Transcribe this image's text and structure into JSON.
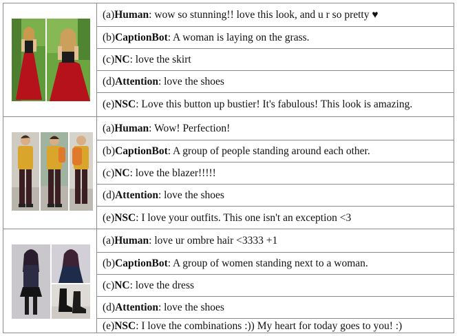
{
  "examples": [
    {
      "images": [
        "woman-red-skirt-photo-left",
        "woman-red-skirt-photo-right"
      ],
      "captions": [
        {
          "prefix": "(a) ",
          "model": "Human",
          "text": ": wow so stunning!! love this look, and u r so pretty ♥"
        },
        {
          "prefix": "(b) ",
          "model": "CaptionBot",
          "text": ": A woman is laying on the grass."
        },
        {
          "prefix": "(c) ",
          "model": "NC",
          "text": ": love the skirt"
        },
        {
          "prefix": "(d) ",
          "model": "Attention",
          "text": ": love the shoes"
        },
        {
          "prefix": "(e) ",
          "model": "NSC",
          "text": ": Love this button up bustier! It's fabulous! This look is amazing."
        }
      ]
    },
    {
      "images": [
        "man-yellow-sweater-photo-1",
        "man-yellow-sweater-photo-2",
        "man-yellow-sweater-photo-3"
      ],
      "captions": [
        {
          "prefix": "(a) ",
          "model": "Human",
          "text": ": Wow! Perfection!"
        },
        {
          "prefix": "(b) ",
          "model": "CaptionBot",
          "text": ": A group of people standing around each other."
        },
        {
          "prefix": "(c) ",
          "model": "NC",
          "text": ": love the blazer!!!!!"
        },
        {
          "prefix": "(d) ",
          "model": "Attention",
          "text": ": love the shoes"
        },
        {
          "prefix": "(e) ",
          "model": "NSC",
          "text": ": I love your outfits. This one isn't an exception <3"
        }
      ]
    },
    {
      "images": [
        "woman-ombre-hair-photo-1",
        "woman-ombre-hair-photo-2",
        "ankle-boots-photo"
      ],
      "captions": [
        {
          "prefix": "(a) ",
          "model": "Human",
          "text": ": love ur ombre hair <3333 +1"
        },
        {
          "prefix": "(b) ",
          "model": "CaptionBot",
          "text": ": A group of women standing next to a woman."
        },
        {
          "prefix": "(c) ",
          "model": "NC",
          "text": ": love the dress"
        },
        {
          "prefix": "(d) ",
          "model": "Attention",
          "text": ": love the shoes"
        },
        {
          "prefix": "(e) ",
          "model": "NSC",
          "text": ": I love the combinations :)) My heart for today goes to you! :)"
        }
      ]
    }
  ],
  "colors": {
    "border": "#8a8a8a",
    "grass": "#5f9a3a",
    "skirt_red": "#b5121b",
    "sweater_yellow": "#d9a52a",
    "backpack_orange": "#e07a2a",
    "pavement": "#b9b5ad"
  }
}
